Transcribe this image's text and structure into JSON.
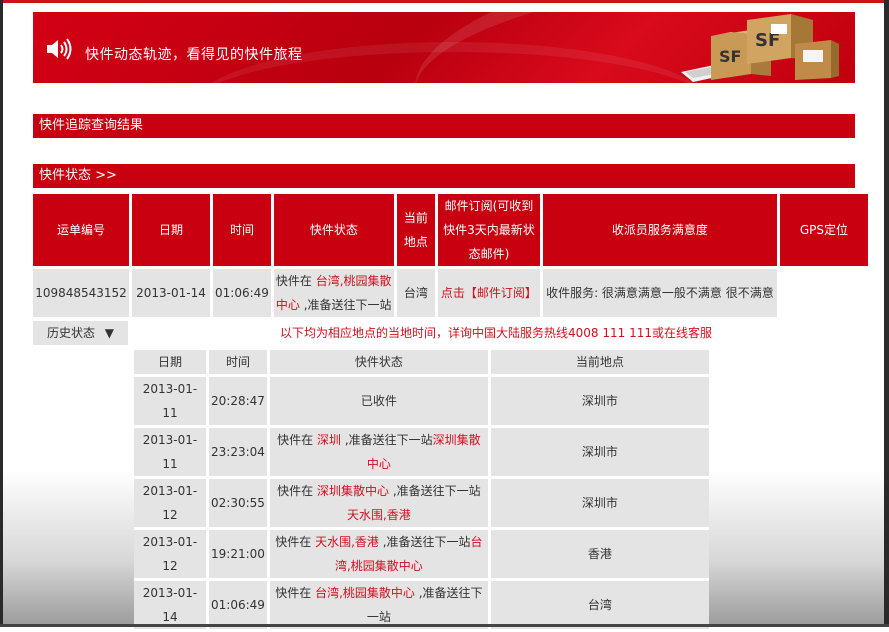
{
  "banner": {
    "title": "快件动态轨迹，看得见的快件旅程"
  },
  "sections": {
    "tracking_result": "快件追踪查询结果",
    "status": "快件状态 >>"
  },
  "main_table": {
    "headers": {
      "waybill": "运单编号",
      "date": "日期",
      "time": "时间",
      "status": "快件状态",
      "location": "当前地点",
      "subscribe": "邮件订阅(可收到快件3天内最新状态邮件)",
      "satisfaction": "收派员服务满意度",
      "gps": "GPS定位"
    },
    "row": {
      "waybill": "109848543152",
      "date": "2013-01-14",
      "time": "01:06:49",
      "status_prefix": "快件在 ",
      "status_place": "台湾,桃园集散中心",
      "status_suffix": " ,准备送往下一站",
      "location": "台湾",
      "subscribe_link": "点击【邮件订阅】",
      "satisfaction": "收件服务: 很满意满意一般不满意 很不满意",
      "gps": ""
    }
  },
  "history": {
    "toggle_label": "历史状态",
    "notice": "以下均为相应地点的当地时间，详询中国大陆服务热线4008 111 111或在线客服",
    "headers": {
      "date": "日期",
      "time": "时间",
      "status": "快件状态",
      "location": "当前地点"
    },
    "rows": [
      {
        "date": "2013-01-11",
        "time": "20:28:47",
        "s1": "已收件",
        "p1": "",
        "s2": "",
        "p2": "",
        "location": "深圳市"
      },
      {
        "date": "2013-01-11",
        "time": "23:23:04",
        "s1": "快件在 ",
        "p1": "深圳",
        "s2": " ,准备送往下一站",
        "p2": "深圳集散中心",
        "location": "深圳市"
      },
      {
        "date": "2013-01-12",
        "time": "02:30:55",
        "s1": "快件在 ",
        "p1": "深圳集散中心",
        "s2": " ,准备送往下一站",
        "p2": "天水围,香港",
        "location": "深圳市"
      },
      {
        "date": "2013-01-12",
        "time": "19:21:00",
        "s1": "快件在 ",
        "p1": "天水围,香港",
        "s2": " ,准备送往下一站",
        "p2": "台湾,桃园集散中心",
        "location": "香港"
      },
      {
        "date": "2013-01-14",
        "time": "01:06:49",
        "s1": "快件在 ",
        "p1": "台湾,桃园集散中心",
        "s2": " ,准备送往下一站",
        "p2": "",
        "location": "台湾"
      }
    ]
  },
  "colors": {
    "brand_red": "#c8000f",
    "link_red": "#d01020",
    "cell_gray": "#e4e4e4"
  }
}
